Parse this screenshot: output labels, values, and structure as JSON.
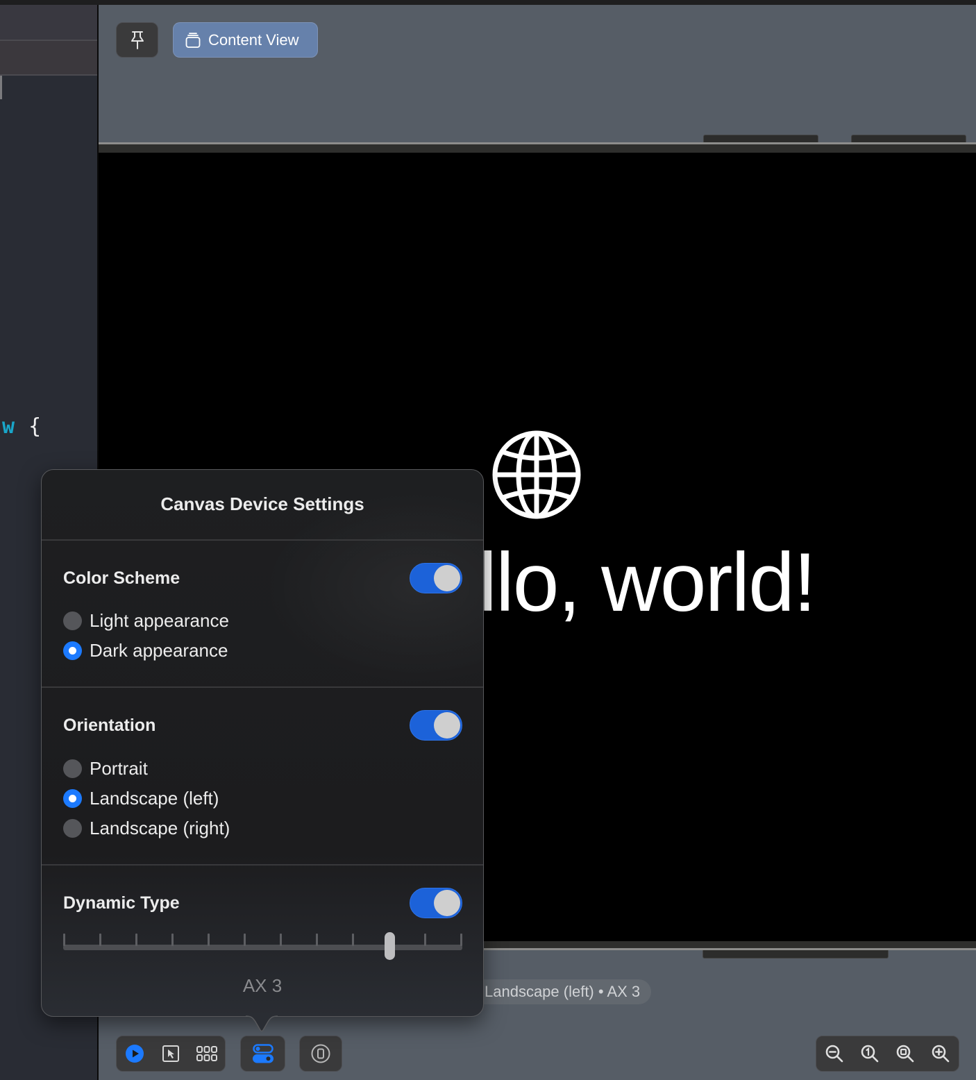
{
  "editor": {
    "code_keyword_fragment": "w",
    "code_brace": "{",
    "code_keyword_color": "#19a6c9"
  },
  "canvas": {
    "pin_button": {
      "icon": "pin-icon"
    },
    "content_view_button": {
      "label": "Content View",
      "icon": "stack-icon"
    }
  },
  "preview": {
    "icon": "globe-icon",
    "text": "Hello, world!"
  },
  "status_pill": {
    "text": "Landscape (left) • AX 3"
  },
  "popover": {
    "title": "Canvas Device Settings",
    "sections": [
      {
        "title": "Color Scheme",
        "enabled": true,
        "options": [
          {
            "label": "Light appearance",
            "selected": false
          },
          {
            "label": "Dark appearance",
            "selected": true
          }
        ]
      },
      {
        "title": "Orientation",
        "enabled": true,
        "options": [
          {
            "label": "Portrait",
            "selected": false
          },
          {
            "label": "Landscape (left)",
            "selected": true
          },
          {
            "label": "Landscape (right)",
            "selected": false
          }
        ]
      },
      {
        "title": "Dynamic Type",
        "enabled": true,
        "slider": {
          "steps": 12,
          "selected_index": 9,
          "value_label": "AX 3"
        }
      }
    ]
  },
  "bottom_toolbar": {
    "mode_group": [
      {
        "name": "live-preview",
        "icon": "play-circle-icon",
        "active": true
      },
      {
        "name": "selectable",
        "icon": "cursor-select-icon",
        "active": false
      },
      {
        "name": "variants",
        "icon": "grid-icon",
        "active": false
      }
    ],
    "device_settings": {
      "icon": "toggles-icon",
      "active": true
    },
    "device": {
      "icon": "iphone-icon",
      "active": false
    },
    "zoom_group": [
      {
        "name": "zoom-out",
        "icon": "zoom-out-icon"
      },
      {
        "name": "zoom-actual",
        "icon": "zoom-100-icon"
      },
      {
        "name": "zoom-fit",
        "icon": "zoom-fit-icon"
      },
      {
        "name": "zoom-in",
        "icon": "zoom-in-icon"
      }
    ]
  },
  "colors": {
    "accent": "#1c7aff",
    "toggle_on": "#1c62d9",
    "content_view_button": "#6681ab",
    "canvas_bg": "#565d66"
  }
}
